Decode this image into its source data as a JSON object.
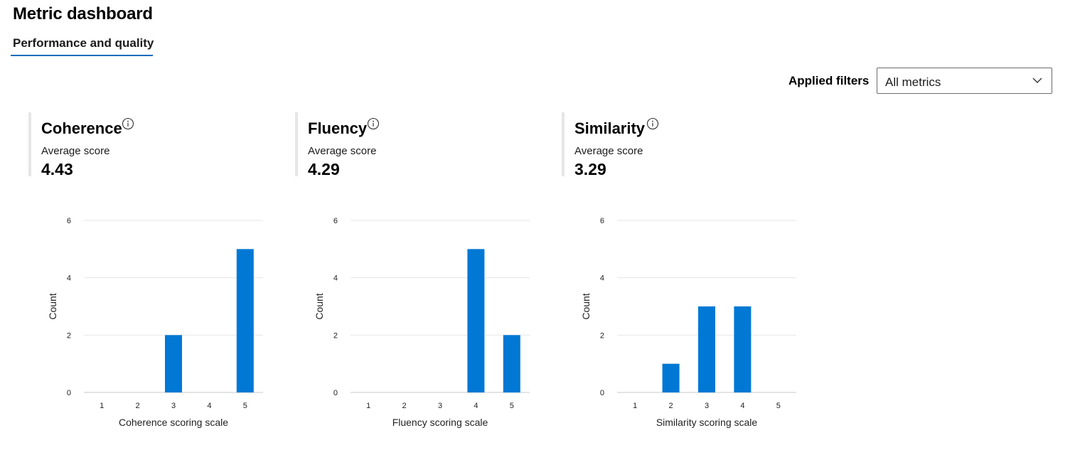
{
  "header": {
    "title": "Metric dashboard",
    "tabs": [
      {
        "label": "Performance and quality",
        "active": true
      }
    ]
  },
  "filters": {
    "label": "Applied filters",
    "selected": "All metrics"
  },
  "colors": {
    "bar": "#0078d4",
    "tab_accent": "#0f6cbd",
    "gridline": "#e6e6e6"
  },
  "metrics": [
    {
      "name": "Coherence",
      "avg_label": "Average score",
      "avg_value": "4.43",
      "icon": "info-icon"
    },
    {
      "name": "Fluency",
      "avg_label": "Average score",
      "avg_value": "4.29",
      "icon": "info-icon"
    },
    {
      "name": "Similarity",
      "avg_label": "Average score",
      "avg_value": "3.29",
      "icon": "info-icon"
    }
  ],
  "chart_data": [
    {
      "type": "bar",
      "categories": [
        "1",
        "2",
        "3",
        "4",
        "5"
      ],
      "values": [
        0,
        0,
        2,
        0,
        5
      ],
      "title": "",
      "xlabel": "Coherence scoring scale",
      "ylabel": "Count",
      "ylim": [
        0,
        6
      ],
      "yticks": [
        0,
        2,
        4,
        6
      ],
      "grid": true
    },
    {
      "type": "bar",
      "categories": [
        "1",
        "2",
        "3",
        "4",
        "5"
      ],
      "values": [
        0,
        0,
        0,
        5,
        2
      ],
      "title": "",
      "xlabel": "Fluency scoring scale",
      "ylabel": "Count",
      "ylim": [
        0,
        6
      ],
      "yticks": [
        0,
        2,
        4,
        6
      ],
      "grid": true
    },
    {
      "type": "bar",
      "categories": [
        "1",
        "2",
        "3",
        "4",
        "5"
      ],
      "values": [
        0,
        1,
        3,
        3,
        0
      ],
      "title": "",
      "xlabel": "Similarity scoring scale",
      "ylabel": "Count",
      "ylim": [
        0,
        6
      ],
      "yticks": [
        0,
        2,
        4,
        6
      ],
      "grid": true
    }
  ]
}
